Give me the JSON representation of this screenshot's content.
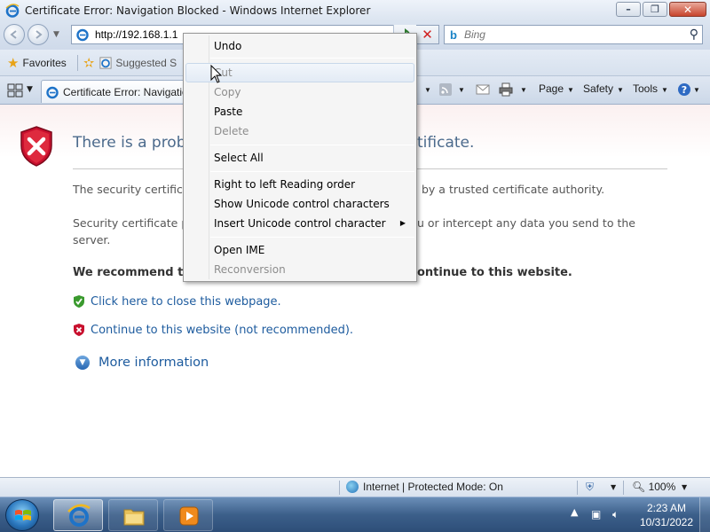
{
  "window": {
    "title": "Certificate Error: Navigation Blocked - Windows Internet Explorer",
    "minimize": "–",
    "maximize": "❐",
    "close": "✕"
  },
  "address_bar": {
    "url": "http://192.168.1.1",
    "stop_glyph": "✕"
  },
  "search": {
    "engine_icon": "b",
    "placeholder": "Bing",
    "button_glyph": "⚲"
  },
  "favorites_bar": {
    "favorites_label": "Favorites",
    "suggested_label": "Suggested S"
  },
  "tab": {
    "label": "Certificate Error: Navigatio"
  },
  "command_bar": {
    "page_label": "Page",
    "safety_label": "Safety",
    "tools_label": "Tools",
    "caret": "▼"
  },
  "content": {
    "title_left": "There is a proble",
    "title_right": "tificate.",
    "para1_left": "The security certifica",
    "para1_right": "by a trusted certificate authority.",
    "para2_left": "Security certificate pr",
    "para2_right": "u or intercept any data you send to the",
    "para2_line2": "server.",
    "recommend_left": "We recommend th",
    "recommend_right": "ontinue to this website.",
    "close_link": "Click here to close this webpage.",
    "continue_link": "Continue to this website (not recommended).",
    "more_info": "More information"
  },
  "context_menu": {
    "items": [
      {
        "label": "Undo",
        "enabled": true
      },
      {
        "label": "Cut",
        "enabled": false
      },
      {
        "label": "Copy",
        "enabled": false
      },
      {
        "label": "Paste",
        "enabled": true
      },
      {
        "label": "Delete",
        "enabled": false
      },
      {
        "label": "Select All",
        "enabled": true
      },
      {
        "label": "Right to left Reading order",
        "enabled": true
      },
      {
        "label": "Show Unicode control characters",
        "enabled": true
      },
      {
        "label": "Insert Unicode control character",
        "enabled": true,
        "submenu_arrow": "▶"
      },
      {
        "label": "Open IME",
        "enabled": true
      },
      {
        "label": "Reconversion",
        "enabled": false
      }
    ]
  },
  "status_bar": {
    "zone_text": "Internet | Protected Mode: On",
    "zoom": "100%",
    "caret": "▼"
  },
  "taskbar": {
    "time": "2:23 AM",
    "date": "10/31/2022",
    "tray_arrow": "▲"
  },
  "colors": {
    "link": "#1d5b9e",
    "heading": "#4b6a8c",
    "error_red": "#c8102e",
    "ok_green": "#3a9a2e"
  },
  "icons": [
    "ie-icon",
    "back-icon",
    "forward-icon",
    "refresh-icon",
    "stop-icon",
    "bing-icon",
    "search-icon",
    "favorites-star-icon",
    "add-favorite-icon",
    "quick-tabs-icon",
    "feeds-icon",
    "mail-icon",
    "print-icon",
    "help-icon",
    "shield-error-icon",
    "shield-ok-icon",
    "globe-icon",
    "windows-start-icon",
    "explorer-folder-icon",
    "media-player-icon",
    "network-icon",
    "volume-icon",
    "mouse-cursor-icon"
  ]
}
